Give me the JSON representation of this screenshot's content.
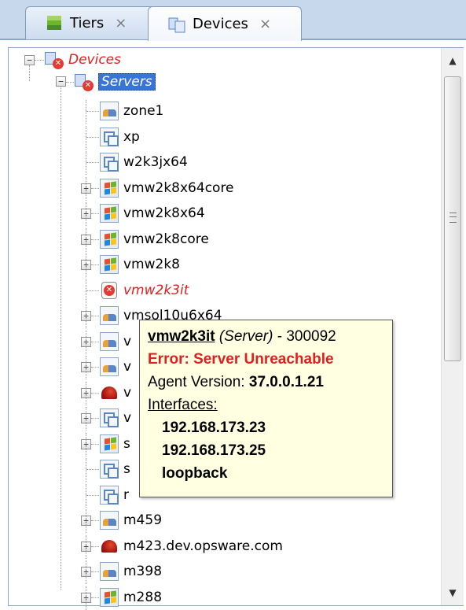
{
  "tabs": [
    {
      "label": "Tiers",
      "close": "×",
      "active": false,
      "icon": "tiers-icon"
    },
    {
      "label": "Devices",
      "close": "×",
      "active": true,
      "icon": "devices-icon"
    }
  ],
  "tree": {
    "root": {
      "label": "Devices",
      "expander": "−",
      "icon": "devices-error-icon"
    },
    "group": {
      "label": "Servers",
      "expander": "−",
      "icon": "servers-error-icon"
    },
    "items": [
      {
        "label": "zone1",
        "icon": "zone-icon",
        "expander": ""
      },
      {
        "label": "xp",
        "icon": "vm-icon",
        "expander": ""
      },
      {
        "label": "w2k3jx64",
        "icon": "vm-icon",
        "expander": ""
      },
      {
        "label": "vmw2k8x64core",
        "icon": "windows-icon",
        "expander": "+"
      },
      {
        "label": "vmw2k8x64",
        "icon": "windows-icon",
        "expander": "+"
      },
      {
        "label": "vmw2k8core",
        "icon": "windows-icon",
        "expander": "+"
      },
      {
        "label": "vmw2k8",
        "icon": "windows-icon",
        "expander": "+"
      },
      {
        "label": "vmw2k3it",
        "icon": "server-error-icon",
        "expander": "",
        "error": true
      },
      {
        "label": "vmsol10u6x64",
        "icon": "zone-icon",
        "expander": "+"
      },
      {
        "label": "v",
        "icon": "zone-icon",
        "expander": "+"
      },
      {
        "label": "v",
        "icon": "zone-icon",
        "expander": "+"
      },
      {
        "label": "v",
        "icon": "linux-icon",
        "expander": "+"
      },
      {
        "label": "v",
        "icon": "vm-icon",
        "expander": "+"
      },
      {
        "label": "s",
        "icon": "windows-icon",
        "expander": "+"
      },
      {
        "label": "s",
        "icon": "vm-icon",
        "expander": ""
      },
      {
        "label": "r",
        "icon": "vm-icon",
        "expander": ""
      },
      {
        "label": "m459",
        "icon": "zone-icon",
        "expander": "+"
      },
      {
        "label": "m423.dev.opsware.com",
        "icon": "linux-icon",
        "expander": "+"
      },
      {
        "label": "m398",
        "icon": "zone-icon",
        "expander": "+"
      },
      {
        "label": "m288",
        "icon": "windows-icon",
        "expander": "+"
      }
    ]
  },
  "tooltip": {
    "name": "vmw2k3it",
    "type": "(Server)",
    "id": "- 300092",
    "error": "Error: Server Unreachable",
    "agent_label": "Agent Version:",
    "agent_version": "37.0.0.1.21",
    "interfaces_label": "Interfaces:",
    "interfaces": [
      "192.168.173.23",
      "192.168.173.25",
      "loopback"
    ]
  },
  "scrollbar": {
    "up": "▲",
    "down": "▼"
  },
  "colors": {
    "error": "#e02020",
    "selection": "#3875d7",
    "tooltip_bg": "#ffffe1"
  }
}
